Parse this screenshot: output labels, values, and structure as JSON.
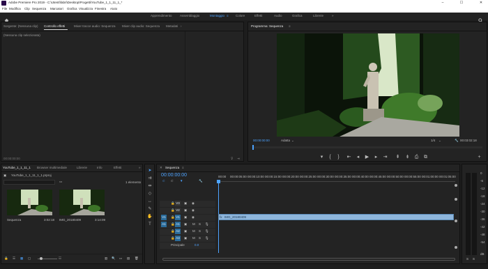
{
  "titlebar": {
    "title": "Adobe Premiere Pro 2019 - C:\\Utenti\\fabri\\Desktop\\Progetti\\YouTube_1_1_11_1_*",
    "controls": [
      "–",
      "☐",
      "✕"
    ]
  },
  "menu": [
    "File",
    "Modifica",
    "Clip",
    "Sequenza",
    "Marcatori",
    "Grafica",
    "Visualizza",
    "Finestra",
    "Aiuto"
  ],
  "workspaces": [
    "Apprendimento",
    "Assemblaggio",
    "Montaggio",
    "Colore",
    "Effetti",
    "Audio",
    "Grafica",
    "Librerie"
  ],
  "workspace_active": "Montaggio",
  "source_panel": {
    "tabs": [
      "Sorgente: (Nessuna clip)",
      "Controllo effetti",
      "Mixer tracce audio: Sequenza",
      "Mixer clip audio: Sequenza",
      "Metadati"
    ],
    "active_tab": "Controllo effetti",
    "empty_text": "(Nessuna clip selezionata)",
    "timecode": "00:00:00:00"
  },
  "program_monitor": {
    "title": "Programma: Sequenza",
    "timecode": "00:00:00:00",
    "fit": "Adatta",
    "resolution": "1/4",
    "duration": "00:03:02:18"
  },
  "project_panel": {
    "tabs": [
      "YouTube_1_1_11_1",
      "Browser multimediale",
      "Librerie",
      "Info",
      "Effetti"
    ],
    "active_tab": "YouTube_1_1_11_1",
    "project_file": "YouTube_1_1_11_1_1.prproj",
    "items_count": "1 elemento",
    "items": [
      {
        "name": "Sequenza",
        "duration": "3:02:18"
      },
      {
        "name": "IMG_20180409",
        "duration": "3:14:09"
      }
    ]
  },
  "timeline": {
    "tab": "Sequenza",
    "timecode": "00:00:00:00",
    "ruler": [
      "00:00",
      "00:00:05:00",
      "00:00:10:00",
      "00:00:15:00",
      "00:00:20:00",
      "00:00:25:00",
      "00:00:30:00",
      "00:00:35:00",
      "00:00:40:00",
      "00:00:45:00",
      "00:00:50:00",
      "00:00:55:00",
      "00:01:00:00",
      "00:01:05:00",
      "00:01:10:00",
      "00:01:15:00"
    ],
    "video_tracks": [
      "V3",
      "V2",
      "V1"
    ],
    "audio_tracks": [
      "A1",
      "A2",
      "A3"
    ],
    "master_label": "Principale",
    "master_value": "0.0",
    "clip_label": "IMG_20180409",
    "source_patch_video": "V1",
    "source_patch_audio": "A1"
  },
  "meter_scale": [
    "0",
    "-6",
    "-12",
    "-18",
    "-24",
    "-30",
    "-36",
    "-42",
    "-48",
    "-54",
    "dB"
  ],
  "colors": {
    "accent": "#4da3ff",
    "clip": "#8eb6dc",
    "track_active": "#2a6b9a"
  }
}
